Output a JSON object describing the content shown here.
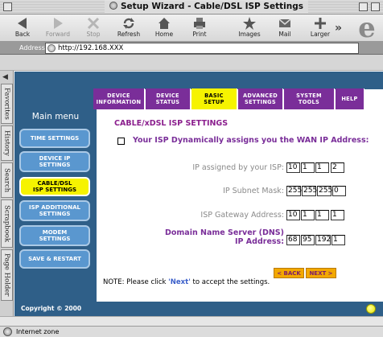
{
  "window": {
    "title": "Setup Wizard - Cable/DSL ISP Settings"
  },
  "toolbar": {
    "buttons": [
      {
        "label": "Back",
        "icon": "back-arrow-icon"
      },
      {
        "label": "Forward",
        "icon": "forward-arrow-icon"
      },
      {
        "label": "Stop",
        "icon": "stop-x-icon"
      },
      {
        "label": "Refresh",
        "icon": "refresh-icon"
      },
      {
        "label": "Home",
        "icon": "home-icon"
      },
      {
        "label": "Print",
        "icon": "print-icon"
      },
      {
        "label": "Images",
        "icon": "images-icon"
      },
      {
        "label": "Mail",
        "icon": "mail-icon"
      },
      {
        "label": "Larger",
        "icon": "larger-text-icon"
      }
    ],
    "more": "»"
  },
  "address": {
    "label": "Address:",
    "url": "http://192.168.XXX"
  },
  "side_tabs": [
    "Favorites",
    "History",
    "Search",
    "Scrapbook",
    "Page Holder"
  ],
  "nav_tabs": [
    {
      "line1": "DEVICE",
      "line2": "INFORMATION",
      "active": false
    },
    {
      "line1": "DEVICE",
      "line2": "STATUS",
      "active": false
    },
    {
      "line1": "BASIC",
      "line2": "SETUP",
      "active": true
    },
    {
      "line1": "ADVANCED",
      "line2": "SETTINGS",
      "active": false
    },
    {
      "line1": "SYSTEM",
      "line2": "TOOLS",
      "active": false
    },
    {
      "line1": "HELP",
      "line2": "",
      "active": false
    }
  ],
  "menu": {
    "title": "Main menu",
    "items": [
      {
        "line1": "TIME SETTINGS",
        "line2": "",
        "active": false
      },
      {
        "line1": "DEVICE IP",
        "line2": "SETTINGS",
        "active": false
      },
      {
        "line1": "CABLE/DSL",
        "line2": "ISP SETTINGS",
        "active": true
      },
      {
        "line1": "ISP ADDITIONAL",
        "line2": "SETTINGS",
        "active": false
      },
      {
        "line1": "MODEM",
        "line2": "SETTINGS",
        "active": false
      },
      {
        "line1": "SAVE & RESTART",
        "line2": "",
        "active": false
      }
    ]
  },
  "content": {
    "section_title": "CABLE/xDSL ISP SETTINGS",
    "dynamic_label": "Your ISP Dynamically assigns you the WAN IP Address:",
    "fields": [
      {
        "label": "IP assigned by your ISP:",
        "octets": [
          "10",
          "1",
          "1",
          "2"
        ]
      },
      {
        "label": "IP Subnet Mask:",
        "octets": [
          "255",
          "255",
          "255",
          "0"
        ]
      },
      {
        "label": "ISP Gateway Address:",
        "octets": [
          "10",
          "1",
          "1",
          "1"
        ]
      },
      {
        "label_line1": "Domain Name Server (DNS)",
        "label_line2": "IP Address:",
        "octets": [
          "68",
          "95",
          "192",
          "1"
        ]
      }
    ],
    "back_label": "< BACK",
    "next_label": "NEXT >",
    "note_prefix": "NOTE: Please click ",
    "note_link": "'Next'",
    "note_suffix": " to accept the settings."
  },
  "footer": {
    "copyright": "Copyright © 2000"
  },
  "status": {
    "zone": "Internet zone"
  },
  "colors": {
    "nav_purple": "#7a2e99",
    "active_yellow": "#f6f300",
    "panel_blue": "#2f5f88",
    "menu_button_blue": "#5a97cf",
    "title_purple": "#8b1f8e",
    "button_orange": "#f3a800"
  }
}
